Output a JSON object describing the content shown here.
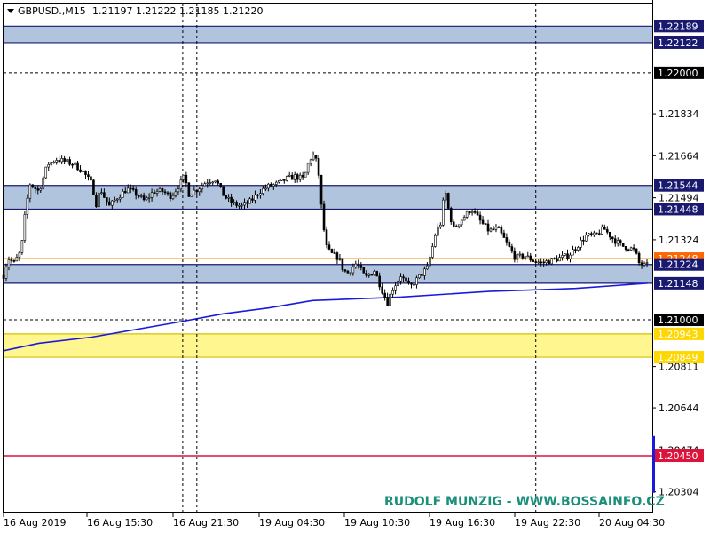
{
  "header": {
    "symbol": "GBPUSD.,M15",
    "ohlc": "1.21197 1.21222 1.21185 1.21220"
  },
  "watermark": "RUDOLF MUNZIG - WWW.BOSSAINFO.CZ",
  "colors": {
    "zone_blue": "#b0c4de",
    "zone_border": "#191970",
    "zone_yellow": "#fff68f",
    "zone_yellow_border": "#d4c200",
    "ma_line": "#1a1adc",
    "red_line": "#dc143c",
    "orange_line": "#ff8c00",
    "candle": "#000000",
    "badge_dark": "#000000",
    "badge_zone": "#191970",
    "badge_orange": "#ff6600",
    "badge_yellow": "#ffd700",
    "badge_red": "#dc143c"
  },
  "chart_data": {
    "type": "candlestick",
    "title": "GBPUSD.,M15",
    "y_range": [
      1.2022,
      1.2228
    ],
    "y_ticks": [
      "1.21834",
      "1.21664",
      "1.21494",
      "1.21324",
      "1.20811",
      "1.20644",
      "1.20474",
      "1.20304"
    ],
    "x_labels": [
      "16 Aug 2019",
      "16 Aug 15:30",
      "16 Aug 21:30",
      "19 Aug 04:30",
      "19 Aug 10:30",
      "19 Aug 16:30",
      "19 Aug 22:30",
      "20 Aug 04:30"
    ],
    "zones": [
      {
        "name": "zone-top",
        "from": 1.22122,
        "to": 1.22189,
        "color": "blue"
      },
      {
        "name": "zone-mid-upper",
        "from": 1.21448,
        "to": 1.21544,
        "color": "blue"
      },
      {
        "name": "zone-mid-lower",
        "from": 1.21148,
        "to": 1.21224,
        "color": "blue"
      },
      {
        "name": "zone-yellow",
        "from": 1.20849,
        "to": 1.20943,
        "color": "yellow"
      }
    ],
    "levels": [
      {
        "value": 1.22,
        "style": "dashed"
      },
      {
        "value": 1.21,
        "style": "dashed"
      },
      {
        "value": 1.2045,
        "style": "red"
      },
      {
        "value": 1.21248,
        "style": "orange"
      }
    ],
    "badges": [
      {
        "text": "1.22189",
        "value": 1.22189,
        "kind": "zone"
      },
      {
        "text": "1.22122",
        "value": 1.22122,
        "kind": "zone"
      },
      {
        "text": "1.22000",
        "value": 1.22,
        "kind": "dark"
      },
      {
        "text": "1.21544",
        "value": 1.21544,
        "kind": "zone"
      },
      {
        "text": "1.21448",
        "value": 1.21448,
        "kind": "zone"
      },
      {
        "text": "1.21248",
        "value": 1.21248,
        "kind": "orange"
      },
      {
        "text": "1.21224",
        "value": 1.21224,
        "kind": "zone"
      },
      {
        "text": "1.21148",
        "value": 1.21148,
        "kind": "zone"
      },
      {
        "text": "1.21000",
        "value": 1.21,
        "kind": "dark"
      },
      {
        "text": "1.20943",
        "value": 1.20943,
        "kind": "yellow"
      },
      {
        "text": "1.20849",
        "value": 1.20849,
        "kind": "yellow"
      },
      {
        "text": "1.20450",
        "value": 1.2045,
        "kind": "red"
      }
    ],
    "ma_points": [
      [
        0,
        1.20875
      ],
      [
        40,
        1.20905
      ],
      [
        100,
        1.2093
      ],
      [
        200,
        1.20992
      ],
      [
        250,
        1.21025
      ],
      [
        300,
        1.21048
      ],
      [
        350,
        1.21078
      ],
      [
        450,
        1.21092
      ],
      [
        550,
        1.21115
      ],
      [
        648,
        1.21127
      ],
      [
        730,
        1.21148
      ]
    ],
    "close_path": [
      [
        0,
        1.2118
      ],
      [
        5,
        1.2125
      ],
      [
        12,
        1.2123
      ],
      [
        20,
        1.2128
      ],
      [
        25,
        1.2145
      ],
      [
        30,
        1.2155
      ],
      [
        40,
        1.2152
      ],
      [
        50,
        1.2163
      ],
      [
        60,
        1.2165
      ],
      [
        70,
        1.2164
      ],
      [
        80,
        1.2163
      ],
      [
        90,
        1.216
      ],
      [
        100,
        1.2155
      ],
      [
        105,
        1.2147
      ],
      [
        110,
        1.2153
      ],
      [
        115,
        1.2149
      ],
      [
        120,
        1.2146
      ],
      [
        130,
        1.215
      ],
      [
        140,
        1.2153
      ],
      [
        150,
        1.2151
      ],
      [
        160,
        1.2148
      ],
      [
        170,
        1.2152
      ],
      [
        180,
        1.2152
      ],
      [
        190,
        1.215
      ],
      [
        200,
        1.2155
      ],
      [
        205,
        1.2158
      ],
      [
        210,
        1.2151
      ],
      [
        220,
        1.2153
      ],
      [
        230,
        1.2156
      ],
      [
        240,
        1.2157
      ],
      [
        250,
        1.215
      ],
      [
        260,
        1.2147
      ],
      [
        270,
        1.2146
      ],
      [
        280,
        1.2148
      ],
      [
        290,
        1.2152
      ],
      [
        300,
        1.2154
      ],
      [
        310,
        1.2155
      ],
      [
        320,
        1.2157
      ],
      [
        330,
        1.2158
      ],
      [
        340,
        1.2157
      ],
      [
        345,
        1.2163
      ],
      [
        350,
        1.2167
      ],
      [
        356,
        1.2163
      ],
      [
        360,
        1.2146
      ],
      [
        365,
        1.213
      ],
      [
        370,
        1.2127
      ],
      [
        380,
        1.2125
      ],
      [
        385,
        1.212
      ],
      [
        390,
        1.2119
      ],
      [
        400,
        1.2123
      ],
      [
        410,
        1.2117
      ],
      [
        420,
        1.212
      ],
      [
        430,
        1.2111
      ],
      [
        435,
        1.2107
      ],
      [
        440,
        1.2112
      ],
      [
        450,
        1.2118
      ],
      [
        460,
        1.2113
      ],
      [
        470,
        1.2117
      ],
      [
        480,
        1.2121
      ],
      [
        485,
        1.2128
      ],
      [
        490,
        1.2136
      ],
      [
        495,
        1.2139
      ],
      [
        500,
        1.2153
      ],
      [
        505,
        1.2143
      ],
      [
        510,
        1.2137
      ],
      [
        520,
        1.2141
      ],
      [
        530,
        1.2145
      ],
      [
        540,
        1.214
      ],
      [
        550,
        1.2136
      ],
      [
        560,
        1.2137
      ],
      [
        570,
        1.2131
      ],
      [
        580,
        1.2125
      ],
      [
        590,
        1.2126
      ],
      [
        600,
        1.2124
      ],
      [
        610,
        1.2123
      ],
      [
        620,
        1.2124
      ],
      [
        630,
        1.2125
      ],
      [
        640,
        1.2126
      ],
      [
        650,
        1.213
      ],
      [
        660,
        1.2134
      ],
      [
        670,
        1.2134
      ],
      [
        680,
        1.2137
      ],
      [
        690,
        1.2133
      ],
      [
        700,
        1.213
      ],
      [
        710,
        1.2129
      ],
      [
        715,
        1.2128
      ],
      [
        720,
        1.2123
      ],
      [
        725,
        1.2122
      ],
      [
        729,
        1.2122
      ]
    ],
    "dashed_times": [
      203,
      219,
      603
    ],
    "x_extent": 735,
    "blue_marker_value_range": [
      1.203,
      1.2053
    ]
  }
}
